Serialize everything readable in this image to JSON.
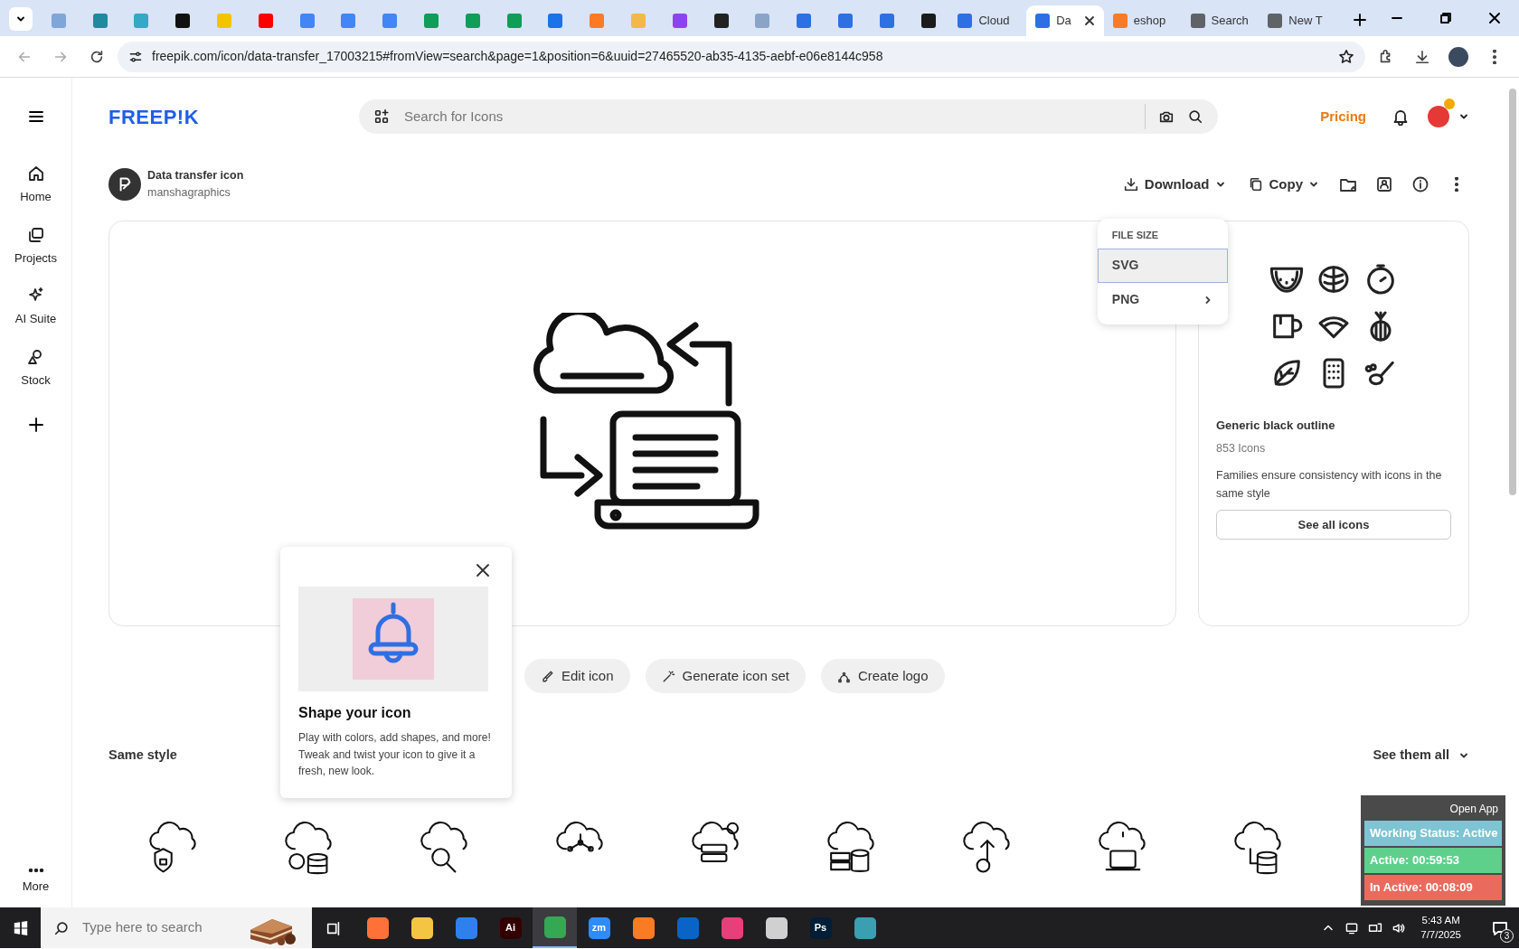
{
  "browser": {
    "tabs": [
      {
        "kind": "icon",
        "color": "#7fa6d8",
        "selected": false
      },
      {
        "kind": "icon",
        "color": "#1f8a9e",
        "selected": false
      },
      {
        "kind": "icon",
        "color": "#34a8c7",
        "selected": false
      },
      {
        "kind": "icon",
        "color": "#111111",
        "selected": false
      },
      {
        "kind": "icon",
        "color": "#f5c400",
        "selected": false
      },
      {
        "kind": "icon",
        "color": "#ff0000",
        "selected": false
      },
      {
        "kind": "icon",
        "color": "#4285f4",
        "selected": false
      },
      {
        "kind": "icon",
        "color": "#4285f4",
        "selected": false
      },
      {
        "kind": "icon",
        "color": "#4285f4",
        "selected": false
      },
      {
        "kind": "icon",
        "color": "#0f9d58",
        "selected": false
      },
      {
        "kind": "icon",
        "color": "#0f9d58",
        "selected": false
      },
      {
        "kind": "icon",
        "color": "#0f9d58",
        "selected": false
      },
      {
        "kind": "icon",
        "color": "#1a73e8",
        "selected": false
      },
      {
        "kind": "icon",
        "color": "#fb7a24",
        "selected": false
      },
      {
        "kind": "icon",
        "color": "#f2b84b",
        "selected": false
      },
      {
        "kind": "icon",
        "color": "#8e44ec",
        "selected": false
      },
      {
        "kind": "icon",
        "color": "#222222",
        "selected": false
      },
      {
        "kind": "icon",
        "color": "#8aa4c8",
        "selected": false
      },
      {
        "kind": "icon",
        "color": "#2f6fe4",
        "selected": false
      },
      {
        "kind": "icon",
        "color": "#2f6fe4",
        "selected": false
      },
      {
        "kind": "icon",
        "color": "#2f6fe4",
        "selected": false
      },
      {
        "kind": "icon",
        "color": "#1b1b1b",
        "selected": false
      },
      {
        "kind": "text",
        "label": "Cloud",
        "color": "#2f6fe4",
        "selected": false
      },
      {
        "kind": "text",
        "label": "Da",
        "color": "#2f6fe4",
        "selected": true
      },
      {
        "kind": "text",
        "label": "eshop",
        "color": "#fb7a24",
        "selected": false
      },
      {
        "kind": "text",
        "label": "Search",
        "color": "#5f6368",
        "selected": false
      },
      {
        "kind": "text",
        "label": "New T",
        "color": "#5f6368",
        "selected": false
      }
    ],
    "address": "freepik.com/icon/data-transfer_17003215#fromView=search&page=1&position=6&uuid=27465520-ab35-4135-aebf-e06e8144c958"
  },
  "sidebar": {
    "items": [
      {
        "label": "Home"
      },
      {
        "label": "Projects"
      },
      {
        "label": "AI Suite"
      },
      {
        "label": "Stock"
      }
    ],
    "more": "More"
  },
  "header": {
    "logo": "FREEP!K",
    "search": {
      "placeholder": "Search for Icons"
    },
    "pricing": "Pricing"
  },
  "asset": {
    "title": "Data transfer icon",
    "author": "manshagraphics",
    "actions": [
      "Download",
      "Copy"
    ]
  },
  "download_menu": {
    "heading": "FILE SIZE",
    "options": [
      {
        "label": "SVG",
        "selected": true,
        "submenu": false
      },
      {
        "label": "PNG",
        "selected": false,
        "submenu": true
      }
    ]
  },
  "family": {
    "title": "Generic black outline",
    "count": "853 Icons",
    "description": "Families ensure consistency with icons in the same style",
    "button": "See all icons"
  },
  "tools": [
    "Edit icon",
    "Generate icon set",
    "Create logo"
  ],
  "popover": {
    "title": "Shape your icon",
    "text": "Play with colors, add shapes, and more! Tweak and twist your icon to give it a fresh, new look."
  },
  "same_style": {
    "heading": "Same style",
    "link": "See them all"
  },
  "tracker": {
    "open_app": "Open App",
    "statuses": [
      {
        "label": "Working Status: Active",
        "color": "#7ec4d3"
      },
      {
        "label": "Active: 00:59:53",
        "color": "#5ed08c"
      },
      {
        "label": "In Active: 00:08:09",
        "color": "#ea6b5d"
      }
    ]
  },
  "taskbar": {
    "search": {
      "placeholder": "Type here to search"
    },
    "apps": [
      {
        "color": "#ff7139",
        "selected": false
      },
      {
        "color": "#f4c542",
        "selected": false
      },
      {
        "color": "#2f80ed",
        "selected": false
      },
      {
        "color": "#330000",
        "label": "Ai",
        "selected": false
      },
      {
        "color": "#34a853",
        "selected": true
      },
      {
        "color": "#2d8cff",
        "label": "zm",
        "selected": false
      },
      {
        "color": "#fb7a24",
        "selected": false
      },
      {
        "color": "#0a64c8",
        "selected": false
      },
      {
        "color": "#e63f7a",
        "selected": false
      },
      {
        "color": "#d0d0d0",
        "selected": false
      },
      {
        "color": "#001e36",
        "label": "Ps",
        "selected": false
      },
      {
        "color": "#3a9fb0",
        "selected": false
      }
    ],
    "time": "5:43 AM",
    "date": "7/7/2025",
    "notifications": "3"
  }
}
